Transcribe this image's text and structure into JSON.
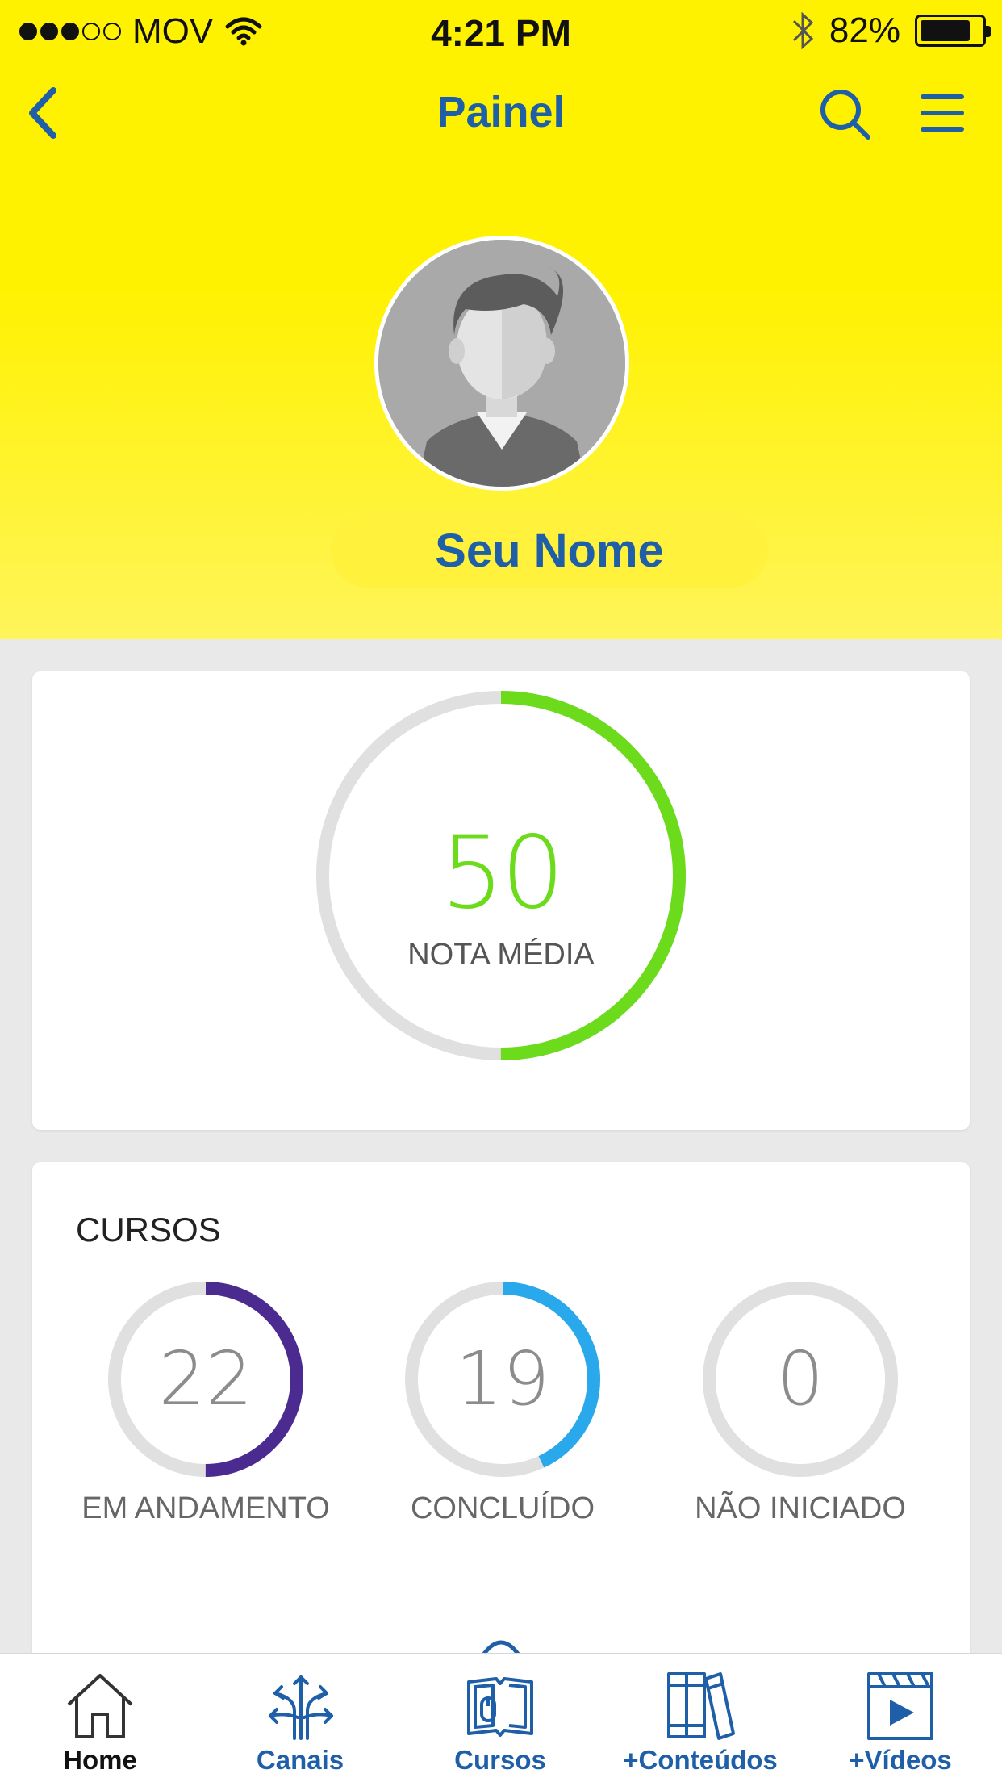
{
  "status_bar": {
    "carrier": "MOV",
    "time": "4:21 PM",
    "battery": "82%",
    "battery_level": 0.82,
    "signal_bars": 3,
    "signal_total": 5,
    "icons": [
      "wifi-icon",
      "bluetooth-icon",
      "battery-icon"
    ]
  },
  "nav": {
    "title": "Painel",
    "icons": [
      "back-chevron-icon",
      "search-icon",
      "hamburger-menu-icon"
    ]
  },
  "profile": {
    "name": "Seu Nome",
    "avatar_icon": "default-user-avatar"
  },
  "grade": {
    "value": "50",
    "label": "NOTA MÉDIA",
    "progress": 0.5,
    "color": "#6cdb1c"
  },
  "courses": {
    "title": "CURSOS",
    "items": [
      {
        "value": "22",
        "label": "EM ANDAMENTO",
        "progress": 0.5,
        "color": "#4b2b8f"
      },
      {
        "value": "19",
        "label": "CONCLUÍDO",
        "progress": 0.43,
        "color": "#2aa8ec"
      },
      {
        "value": "0",
        "label": "NÃO INICIADO",
        "progress": 0,
        "color": "#e0e0e0"
      }
    ]
  },
  "tabbar": {
    "items": [
      {
        "label": "Home",
        "icon": "home-icon",
        "active": true
      },
      {
        "label": "Canais",
        "icon": "channels-arrows-icon",
        "active": false
      },
      {
        "label": "Cursos",
        "icon": "courses-book-mouse-icon",
        "active": false
      },
      {
        "label": "+Conteúdos",
        "icon": "books-icon",
        "active": false
      },
      {
        "label": "+Vídeos",
        "icon": "video-clapper-icon",
        "active": false
      }
    ]
  },
  "colors": {
    "header_yellow": "#fff200",
    "brand_blue": "#1e5fa8",
    "ring_track": "#e0e0e0"
  }
}
